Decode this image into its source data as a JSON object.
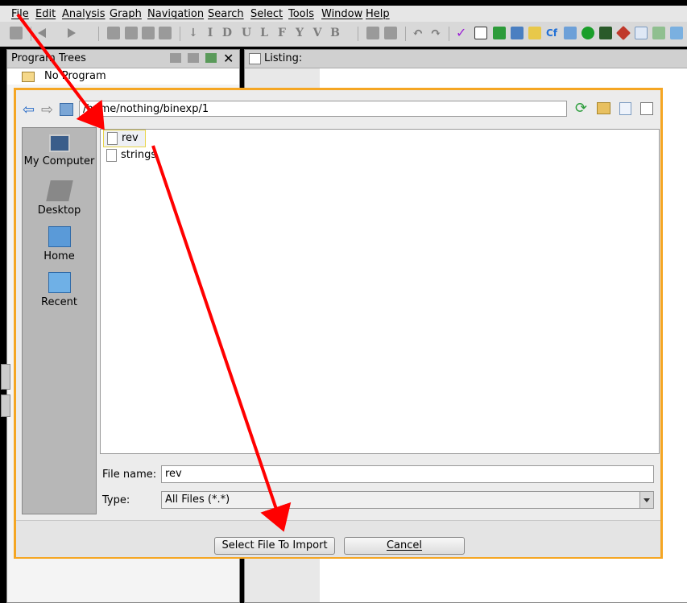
{
  "menubar": {
    "items": [
      "File",
      "Edit",
      "Analysis",
      "Graph",
      "Navigation",
      "Search",
      "Select",
      "Tools",
      "Window",
      "Help"
    ]
  },
  "program_trees": {
    "title": "Program Trees",
    "tree_item": "No Program"
  },
  "listing": {
    "title": "Listing:"
  },
  "toolbar": {
    "letter_icons": [
      "I",
      "D",
      "U",
      "L",
      "F",
      "Y",
      "V",
      "B"
    ],
    "accent_colors": {
      "check": "#9b1fd6",
      "run": "#1a9e2a",
      "config": "#1f6fd6"
    }
  },
  "dialog": {
    "path": "/home/nothing/binexp/1",
    "places": [
      {
        "label": "My Computer",
        "icon": "computer-icon"
      },
      {
        "label": "Desktop",
        "icon": "desktop-icon"
      },
      {
        "label": "Home",
        "icon": "home-folder-icon"
      },
      {
        "label": "Recent",
        "icon": "recent-folder-icon"
      }
    ],
    "files": [
      {
        "name": "rev",
        "selected": true
      },
      {
        "name": "strings",
        "selected": false
      }
    ],
    "file_name_label": "File name:",
    "file_name_value": "rev",
    "type_label": "Type:",
    "type_value": "All Files (*.*)",
    "select_button": "Select File To Import",
    "cancel_button": "Cancel",
    "border_color": "#f5a623"
  },
  "annotation": {
    "arrow_color": "#ff0000"
  }
}
